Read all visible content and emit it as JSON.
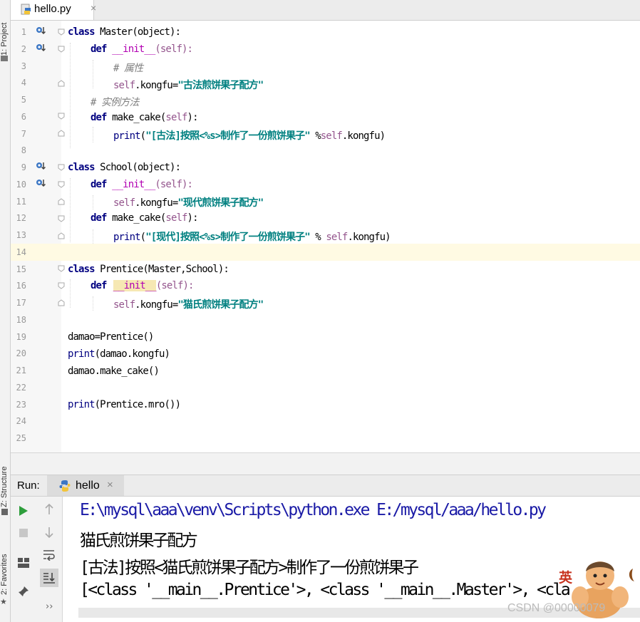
{
  "tool_strip": {
    "project": "1: Project",
    "structure": "Z: Structure",
    "favorites": "2: Favorites"
  },
  "editor_tab": {
    "label": "hello.py",
    "close": "×"
  },
  "lines": [
    {
      "n": "1"
    },
    {
      "n": "2"
    },
    {
      "n": "3"
    },
    {
      "n": "4"
    },
    {
      "n": "5"
    },
    {
      "n": "6"
    },
    {
      "n": "7"
    },
    {
      "n": "8"
    },
    {
      "n": "9"
    },
    {
      "n": "10"
    },
    {
      "n": "11"
    },
    {
      "n": "12"
    },
    {
      "n": "13"
    },
    {
      "n": "14"
    },
    {
      "n": "15"
    },
    {
      "n": "16"
    },
    {
      "n": "17"
    },
    {
      "n": "18"
    },
    {
      "n": "19"
    },
    {
      "n": "20"
    },
    {
      "n": "21"
    },
    {
      "n": "22"
    },
    {
      "n": "23"
    },
    {
      "n": "24"
    },
    {
      "n": "25"
    }
  ],
  "code": {
    "l1": [
      "class",
      " Master(object):"
    ],
    "l2": [
      "def",
      " __init__",
      "(self):"
    ],
    "l3": "# 属性",
    "l4": [
      "self",
      ".kongfu=",
      "\"古法煎饼果子配方\""
    ],
    "l5": "# 实例方法",
    "l6": [
      "def",
      " make_cake(",
      "self",
      "):"
    ],
    "l7": [
      "print",
      "(",
      "\"[古法]按照<%s>制作了一份煎饼果子\"",
      " %",
      "self",
      ".kongfu)"
    ],
    "l9": [
      "class",
      " School(object):"
    ],
    "l10": [
      "def",
      " __init__",
      "(self):"
    ],
    "l11": [
      "self",
      ".kongfu=",
      "\"现代煎饼果子配方\""
    ],
    "l12": [
      "def",
      " make_cake(",
      "self",
      "):"
    ],
    "l13": [
      "print",
      "(",
      "\"[现代]按照<%s>制作了一份煎饼果子\"",
      " % ",
      "self",
      ".kongfu)"
    ],
    "l15": [
      "class",
      " Prentice(Master,School):"
    ],
    "l16": [
      "def",
      "__init__",
      "(self):"
    ],
    "l17": [
      "self",
      ".kongfu=",
      "\"猫氏煎饼果子配方\""
    ],
    "l19": "damao=Prentice()",
    "l20": [
      "print",
      "(damao.kongfu)"
    ],
    "l21": "damao.make_cake()",
    "l23": [
      "print",
      "(Prentice.mro())"
    ]
  },
  "run_panel": {
    "label": "Run:",
    "tab": "hello",
    "close": "×",
    "output": [
      "E:\\mysql\\aaa\\venv\\Scripts\\python.exe E:/mysql/aaa/hello.py",
      "猫氏煎饼果子配方",
      "[古法]按照<猫氏煎饼果子配方>制作了一份煎饼果子",
      "[<class '__main__.Prentice'>, <class '__main__.Master'>, <cla"
    ]
  },
  "watermark": "CSDN @00000079",
  "sticker_text": "英",
  "colors": {
    "keyword": "#000080",
    "string": "#008080",
    "comment": "#808080",
    "self": "#94558d",
    "highlight_line": "#fffae3"
  }
}
